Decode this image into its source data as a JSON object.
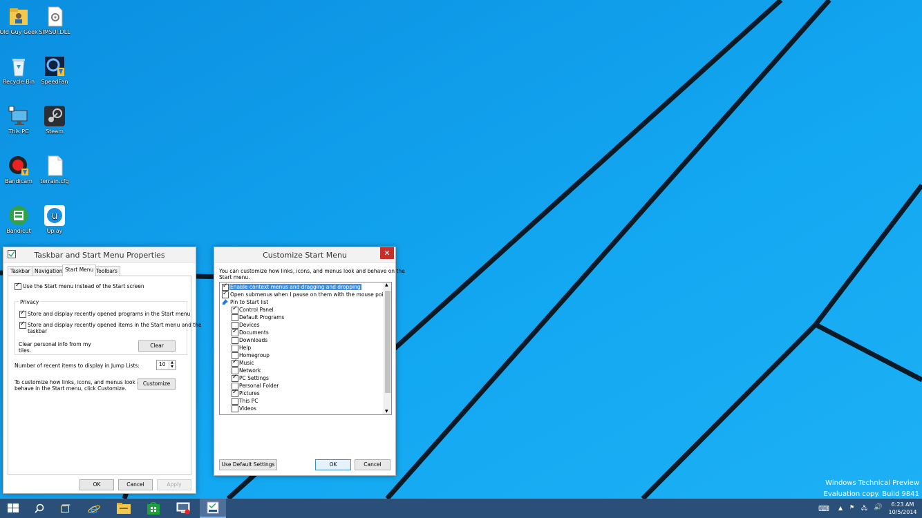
{
  "desktop": {
    "icons": [
      {
        "label": "Old Guy Geek",
        "icon": "folder-user-icon"
      },
      {
        "label": "SIMSUI.DLL",
        "icon": "dll-file-icon"
      },
      {
        "label": "Recycle Bin",
        "icon": "recycle-bin-icon"
      },
      {
        "label": "SpeedFan",
        "icon": "speedfan-icon"
      },
      {
        "label": "This PC",
        "icon": "computer-icon"
      },
      {
        "label": "Steam",
        "icon": "steam-icon"
      },
      {
        "label": "Bandicam",
        "icon": "bandicam-icon"
      },
      {
        "label": "terrain.cfg",
        "icon": "text-file-icon"
      },
      {
        "label": "Bandicut",
        "icon": "bandicut-icon"
      },
      {
        "label": "Uplay",
        "icon": "uplay-icon"
      }
    ],
    "watermark": {
      "line1": "Windows Technical Preview",
      "line2": "Evaluation copy. Build 9841"
    }
  },
  "taskbar_props": {
    "title": "Taskbar and Start Menu Properties",
    "tabs": [
      "Taskbar",
      "Navigation",
      "Start Menu",
      "Toolbars"
    ],
    "use_start_menu": "Use the Start menu instead of the Start screen",
    "privacy_label": "Privacy",
    "privacy_programs": "Store and display recently opened programs in the Start menu",
    "privacy_items_1": "Store and display recently opened items in the Start menu and the",
    "privacy_items_2": "taskbar",
    "clear_info_1": "Clear personal info from my",
    "clear_info_2": "tiles.",
    "clear_button": "Clear",
    "jumplist_label": "Number of recent items to display in Jump Lists:",
    "jumplist_value": "10",
    "customize_text_1": "To customize how links, icons, and menus look and",
    "customize_text_2": "behave in the Start menu, click Customize.",
    "customize_button": "Customize",
    "ok": "OK",
    "cancel": "Cancel",
    "apply": "Apply"
  },
  "customize": {
    "title": "Customize Start Menu",
    "desc_1": "You can customize how links, icons, and menus look and behave on the",
    "desc_2": "Start menu.",
    "items": [
      {
        "label": "Enable context menus and dragging and dropping",
        "checked": true
      },
      {
        "label": "Open submenus when I pause on them with the mouse pointer",
        "checked": true
      },
      {
        "label": "Pin to Start list",
        "checked": false
      },
      {
        "label": "Control Panel",
        "checked": true
      },
      {
        "label": "Default Programs",
        "checked": false
      },
      {
        "label": "Devices",
        "checked": false
      },
      {
        "label": "Documents",
        "checked": true
      },
      {
        "label": "Downloads",
        "checked": false
      },
      {
        "label": "Help",
        "checked": false
      },
      {
        "label": "Homegroup",
        "checked": false
      },
      {
        "label": "Music",
        "checked": true
      },
      {
        "label": "Network",
        "checked": false
      },
      {
        "label": "PC Settings",
        "checked": true
      },
      {
        "label": "Personal Folder",
        "checked": false
      },
      {
        "label": "Pictures",
        "checked": true
      },
      {
        "label": "This PC",
        "checked": false
      },
      {
        "label": "Videos",
        "checked": false
      }
    ],
    "default_button": "Use Default Settings",
    "ok": "OK",
    "cancel": "Cancel"
  },
  "taskbar": {
    "clock_time": "6:23 AM",
    "clock_date": "10/5/2014"
  }
}
